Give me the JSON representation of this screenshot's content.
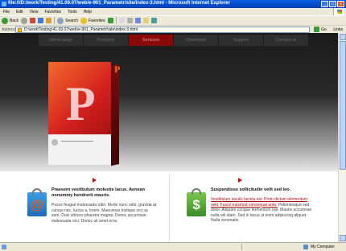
{
  "window": {
    "title": "file:///D:/work/Testing/41.09.07/web/e-901_Parametr/site/index-3.html - Microsoft Internet Explorer",
    "minimize": "_",
    "maximize": "□",
    "close": "x"
  },
  "menu": {
    "items": [
      "File",
      "Edit",
      "View",
      "Favorites",
      "Tools",
      "Help"
    ]
  },
  "toolbar": {
    "back_label": "Back",
    "search_label": "Search",
    "favorites_label": "Favorites"
  },
  "addressbar": {
    "label": "Address",
    "value": "D:\\work\\Testing\\41.09.07\\web\\e-901_Parametr\\site\\index-3.html",
    "go_label": "Go",
    "links_label": "Links"
  },
  "site": {
    "nav": [
      "Home page",
      "Products",
      "Services",
      "Download",
      "Support",
      "Contact us"
    ],
    "active_nav": "Services",
    "box_letter": "P",
    "box_letter_small": "P",
    "left": {
      "heading": "Praesent vestibulum molestie lacus. Aenean nonummy hendrerit mauris.",
      "body": "Pusce feugiat malesuada odio. Morbi nunc odio, gravida at, cursus nec, luctus a, lorem. Maecenas tristique orci ac sem. Duis ultrices pharetra magna. Donec accumsan malesuada orci. Donec sit amet eros.",
      "icon_glyph": "@"
    },
    "right": {
      "heading": "Suspendisse sollicitudin velit sed leo.",
      "link_text": "Vestibulum iaculis lacinia est. Proin dictum elementum velit. Fusce euismod consequat ante.",
      "body": "Pellentesque sed dolor. Aliquam congue fermentum nisl. Mauris accumsan nulla vel diam. Sed in lacus ut enim adipiscing aliquet. Nulla venenatis.",
      "icon_glyph": "$"
    }
  },
  "status": {
    "left": "",
    "zone": "My Computer"
  },
  "colors": {
    "accent_red": "#8a0a0a",
    "box_red": "#d31f1f",
    "ie_blue": "#0a5ede"
  }
}
